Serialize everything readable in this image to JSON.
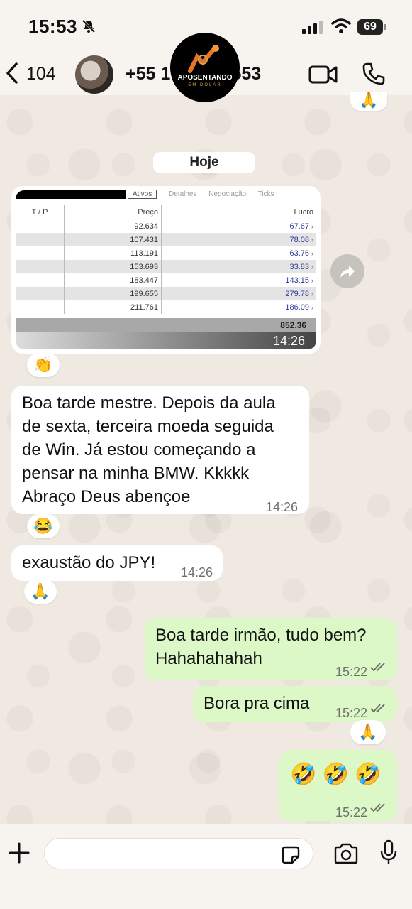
{
  "status_bar": {
    "time": "15:53",
    "battery": "69"
  },
  "header": {
    "unread_count": "104",
    "contact_left": "+55 1",
    "contact_right": "-3553",
    "logo_text": "APOSENTANDO",
    "logo_subtext": "EM DOLAR"
  },
  "date_chip": "Hoje",
  "image_message": {
    "tabs": [
      "Ativos",
      "Detalhes",
      "Negociação",
      "Ticks"
    ],
    "columns": [
      "T / P",
      "Preço",
      "Lucro"
    ],
    "rows": [
      {
        "preco": "92.634",
        "lucro": "67.67"
      },
      {
        "preco": "107.431",
        "lucro": "78.08"
      },
      {
        "preco": "113.191",
        "lucro": "63.76"
      },
      {
        "preco": "153.693",
        "lucro": "33.83"
      },
      {
        "preco": "183.447",
        "lucro": "143.15"
      },
      {
        "preco": "199.655",
        "lucro": "279.78"
      },
      {
        "preco": "211.761",
        "lucro": "186.09"
      }
    ],
    "total": "852.36",
    "time": "14:26"
  },
  "reactions": {
    "r1": "👏",
    "r2": "😂",
    "r3": "🙏",
    "r4": "🙏",
    "r_top": "🙏"
  },
  "messages": {
    "m1": {
      "lines": [
        "Boa tarde mestre. Depois da aula",
        "de sexta, terceira moeda seguida",
        "de Win. Já estou começando a",
        "pensar na minha BMW. Kkkkk",
        "Abraço Deus abençoe"
      ],
      "time": "14:26"
    },
    "m2": {
      "text": "exaustão do JPY!",
      "time": "14:26"
    },
    "m3": {
      "lines": [
        "Boa tarde irmão, tudo bem?",
        "Hahahahahah"
      ],
      "time": "15:22"
    },
    "m4": {
      "text": "Bora pra cima",
      "time": "15:22"
    },
    "m5": {
      "text": "🤣 🤣 🤣",
      "time": "15:22"
    }
  },
  "composer": {
    "placeholder": ""
  }
}
